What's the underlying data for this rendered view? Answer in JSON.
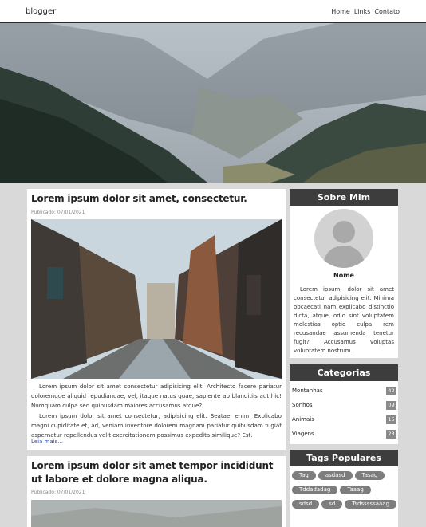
{
  "nav": {
    "brand": "blogger",
    "links": [
      "Home",
      "Links",
      "Contato"
    ]
  },
  "hero": {
    "image": "mountain valley with pine forest"
  },
  "posts": [
    {
      "title": "Lorem ipsum dolor sit amet, consectetur.",
      "date": "Publicado: 07/01/2021",
      "image": "cobblestone street between old buildings",
      "paragraphs": [
        "Lorem ipsum dolor sit amet consectetur adipisicing elit. Architecto facere pariatur doloremque aliquid repudiandae, vel, itaque natus quae, sapiente ab blanditiis aut hic! Numquam culpa sed quibusdam maiores accusamus atque?",
        "Lorem ipsum dolor sit amet consectetur, adipisicing elit. Beatae, enim! Explicabo magni cupiditate et, ad, veniam inventore dolorem magnam pariatur quibusdam fugiat aspernatur repellendus velit exercitationem possimus expedita similique? Est."
      ],
      "read_more": "Leia mais..."
    },
    {
      "title": "Lorem ipsum dolor sit amet tempor incididunt ut labore et dolore magna aliqua.",
      "date": "Publicado: 07/01/2021",
      "image": "misty landscape"
    }
  ],
  "about": {
    "heading": "Sobre Mim",
    "name": "Nome",
    "text": "Lorem ipsum, dolor sit amet consectetur adipisicing elit. Minima obcaecati nam explicabo distinctio dicta, atque, odio sint voluptatem molestias optio culpa rem recusandae assumenda tenetur fugit? Accusamus voluptas voluptatem nostrum."
  },
  "categories": {
    "heading": "Categorias",
    "items": [
      {
        "label": "Montanhas",
        "count": "42"
      },
      {
        "label": "Sonhos",
        "count": "09"
      },
      {
        "label": "Animais",
        "count": "15"
      },
      {
        "label": "Viagens",
        "count": "23"
      }
    ]
  },
  "tags": {
    "heading": "Tags Populares",
    "items": [
      "Tag",
      "asdasd",
      "Tasag",
      "Tddadadag",
      "Taaag",
      "sdsd",
      "sd",
      "Tsdsssssaaag"
    ]
  }
}
